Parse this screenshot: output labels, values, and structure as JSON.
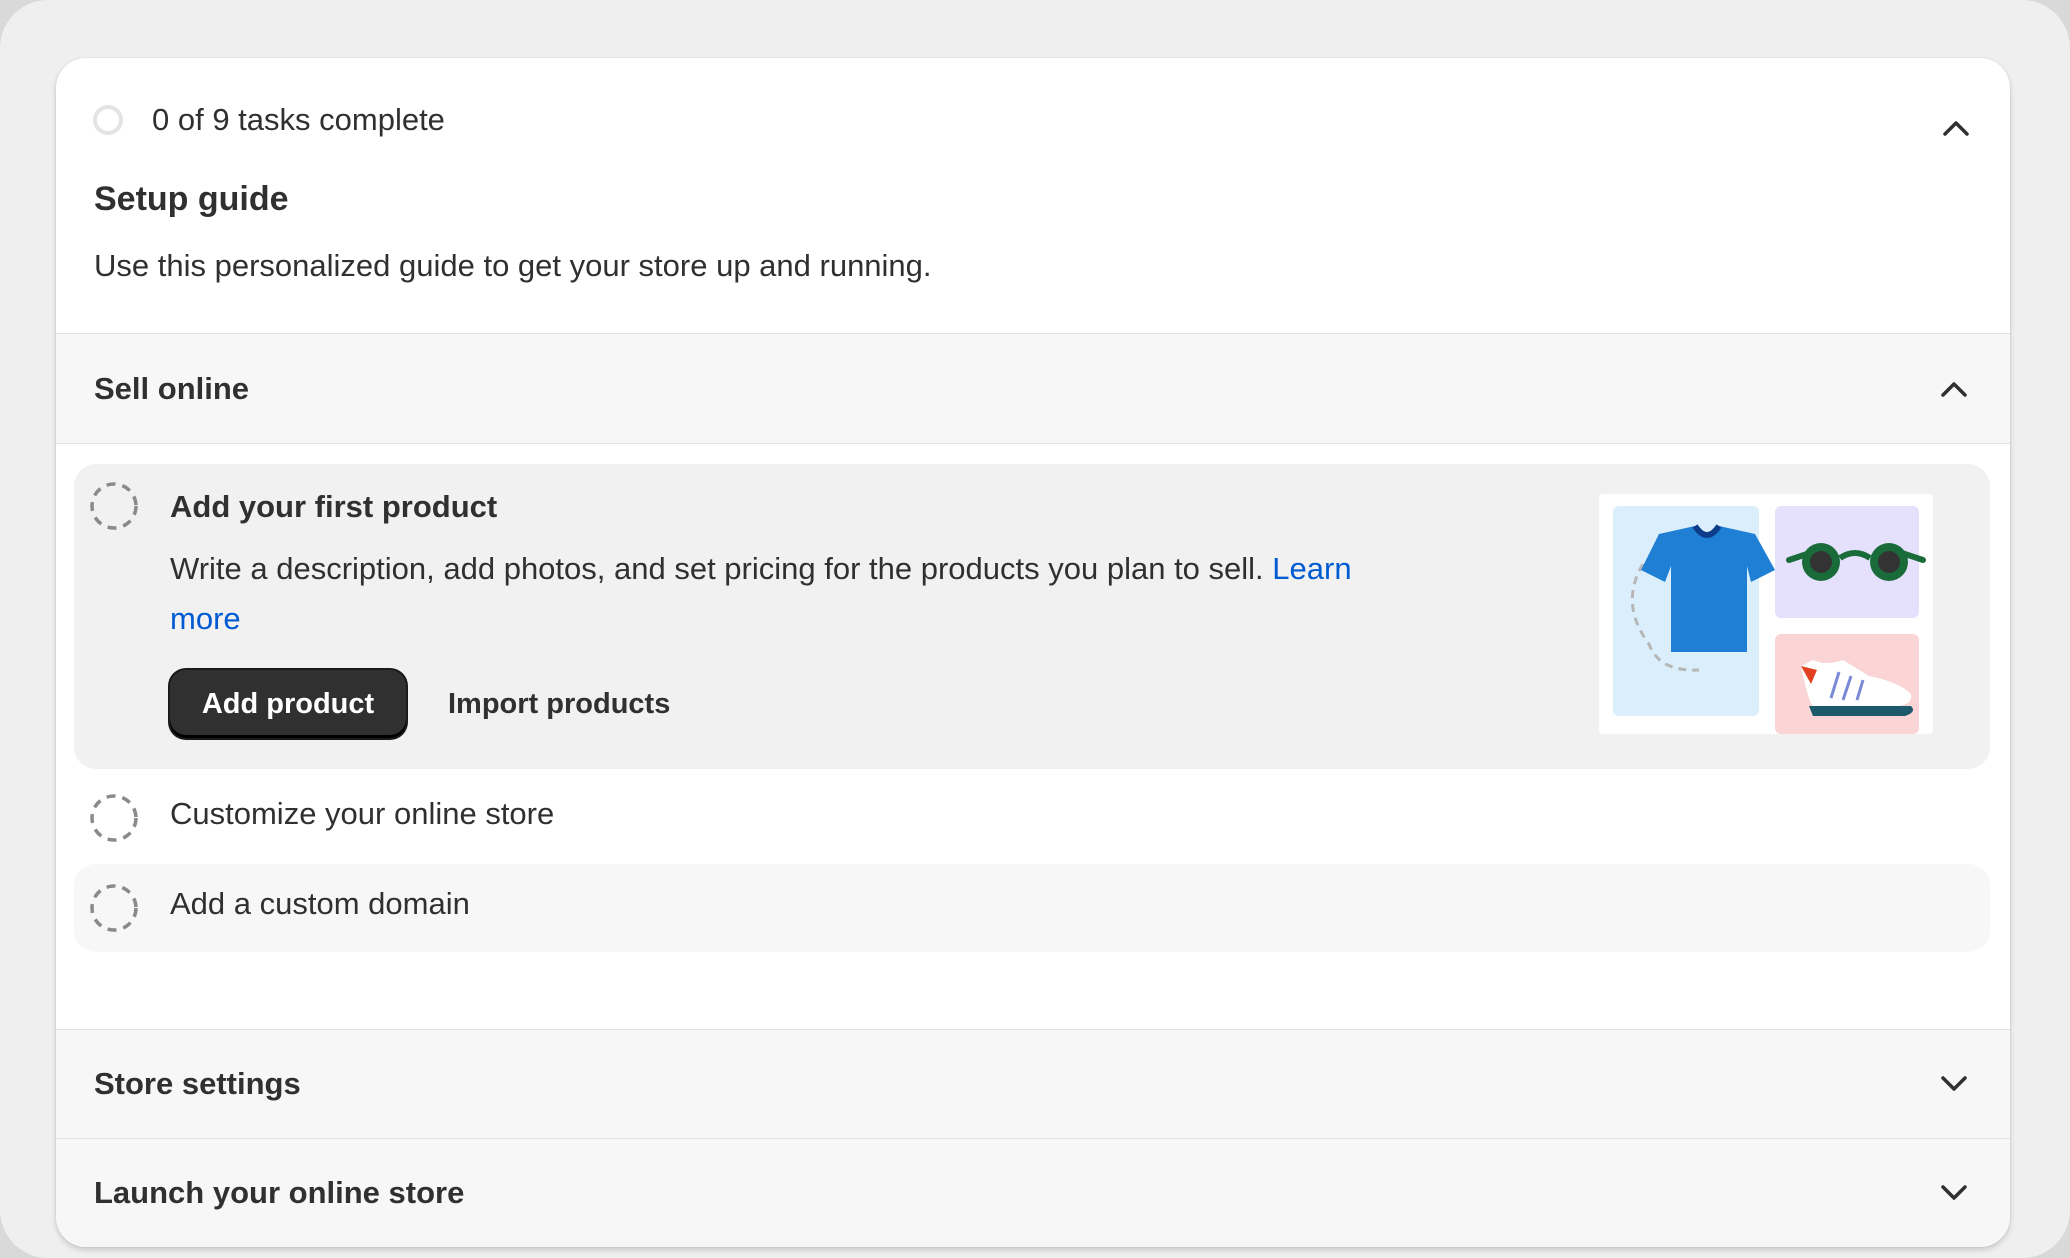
{
  "header": {
    "progress_text": "0 of 9 tasks complete",
    "title": "Setup guide",
    "subtitle": "Use this personalized guide to get your store up and running."
  },
  "sections": [
    {
      "label": "Sell online",
      "expanded": true
    },
    {
      "label": "Store settings",
      "expanded": false
    },
    {
      "label": "Launch your online store",
      "expanded": false
    }
  ],
  "tasks": [
    {
      "title": "Add your first product",
      "description": "Write a description, add photos, and set pricing for the products you plan to sell.",
      "link_text": "Learn more",
      "primary_button": "Add product",
      "secondary_button": "Import products",
      "illustration_icons": [
        "t-shirt-icon",
        "sunglasses-icon",
        "sneaker-icon"
      ]
    },
    {
      "title": "Customize your online store"
    },
    {
      "title": "Add a custom domain"
    }
  ],
  "colors": {
    "link": "#005bd3",
    "primary_button_bg": "#303030",
    "text": "#303030",
    "tshirt_blue": "#1e7fd4",
    "tile_light_blue": "#dbeefb",
    "tile_lavender": "#e5e0fb",
    "tile_pink": "#fbd5d5"
  }
}
